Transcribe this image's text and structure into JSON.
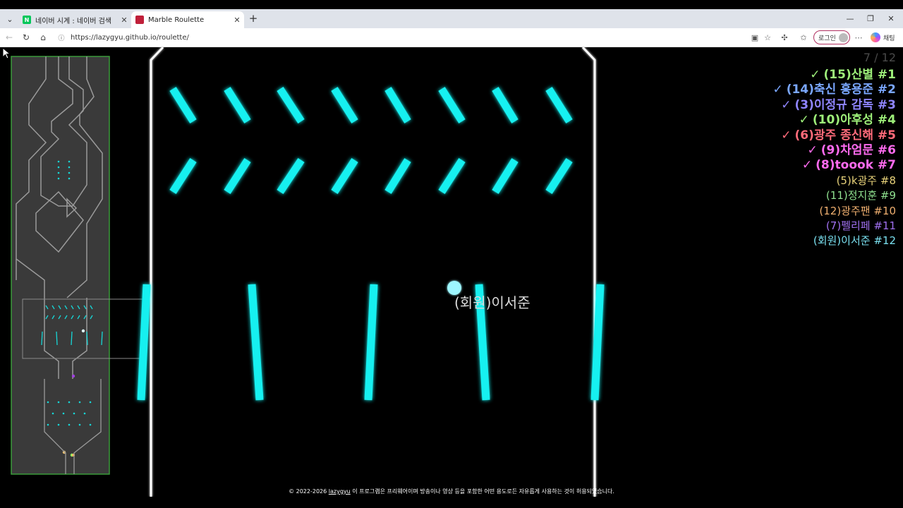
{
  "browser": {
    "tabs": [
      {
        "title": "네이버 시계 : 네이버 검색",
        "favicon": "naver-favicon",
        "favicon_letter": "N",
        "favicon_color": "#03c75a",
        "active": false
      },
      {
        "title": "Marble Roulette",
        "favicon": "marble-roulette-favicon",
        "favicon_color": "#c0203a",
        "active": true
      }
    ],
    "new_tab": "+",
    "url": "https://lazygyu.github.io/roulette/",
    "login_label": "로그인",
    "copilot_label": "채팅"
  },
  "game": {
    "counter": "7 / 12",
    "ranking": [
      {
        "mark": "✓",
        "text": "(15)산별 #1",
        "color": "#9ef07a",
        "finished": true
      },
      {
        "mark": "✓",
        "text": "(14)축신 홍용준 #2",
        "color": "#7aa7ff",
        "finished": true
      },
      {
        "mark": "✓",
        "text": "(3)이정규 감독 #3",
        "color": "#8f85ff",
        "finished": true
      },
      {
        "mark": "✓",
        "text": "(10)아후성 #4",
        "color": "#9ef07a",
        "finished": true
      },
      {
        "mark": "✓",
        "text": "(6)광주 종신해 #5",
        "color": "#ff6b7a",
        "finished": true
      },
      {
        "mark": "✓",
        "text": "(9)차엄문 #6",
        "color": "#ff6bf0",
        "finished": true
      },
      {
        "mark": "✓",
        "text": "(8)toook #7",
        "color": "#ff6bf0",
        "finished": true
      },
      {
        "mark": "",
        "text": "(5)k광주 #8",
        "color": "#e8d27a",
        "finished": false
      },
      {
        "mark": "",
        "text": "(11)정지훈 #9",
        "color": "#8fe08f",
        "finished": false
      },
      {
        "mark": "",
        "text": "(12)광주팬 #10",
        "color": "#f0b070",
        "finished": false
      },
      {
        "mark": "",
        "text": "(7)펠리페 #11",
        "color": "#a070f0",
        "finished": false
      },
      {
        "mark": "",
        "text": "(회원)이서준 #12",
        "color": "#7ae0f0",
        "finished": false
      }
    ],
    "marble_label": "(회원)이서준",
    "footer": {
      "prefix": "© 2022-2026",
      "author": "lazygyu",
      "suffix": "이 프로그램은 프리웨어이며 방송이나 영상 등을 포함한 어떤 용도로든 자유롭게 사용하는 것이 허용되었습니다."
    },
    "colors": {
      "peg": "#16f0f0",
      "wall": "#ffffff",
      "marble": "#9ef6ff",
      "minimap_bg": "#3a3a3a",
      "minimap_border": "#3a9a3a"
    }
  }
}
